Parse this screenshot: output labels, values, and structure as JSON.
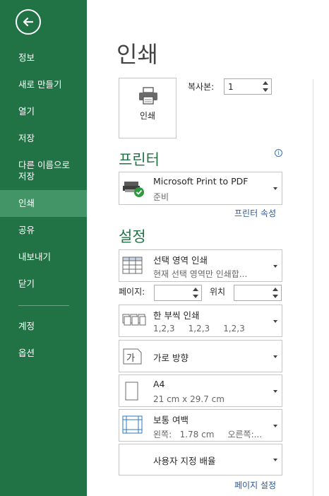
{
  "sidebar": {
    "items": [
      {
        "label": "정보"
      },
      {
        "label": "새로 만들기"
      },
      {
        "label": "열기"
      },
      {
        "label": "저장"
      },
      {
        "label": "다른 이름으로\n저장"
      },
      {
        "label": "인쇄"
      },
      {
        "label": "공유"
      },
      {
        "label": "내보내기"
      },
      {
        "label": "닫기"
      },
      {
        "label": "계정"
      },
      {
        "label": "옵션"
      }
    ],
    "active_index": 5
  },
  "page": {
    "title": "인쇄"
  },
  "print": {
    "button_label": "인쇄",
    "copies_label": "복사본:",
    "copies_value": "1"
  },
  "printer": {
    "heading": "프린터",
    "name": "Microsoft Print to PDF",
    "status": "준비",
    "properties_link": "프린터 속성"
  },
  "settings": {
    "heading": "설정",
    "scope": {
      "title": "선택 영역 인쇄",
      "subtitle": "현재 선택 영역만 인쇄합..."
    },
    "pages": {
      "label": "페이지:",
      "from": "",
      "to_label": "위치",
      "to": ""
    },
    "collate": {
      "title": "한 부씩 인쇄",
      "subtitle": "1,2,3     1,2,3     1,2,3"
    },
    "orientation": {
      "title": "가로 방향"
    },
    "paper": {
      "title": "A4",
      "subtitle": "21 cm x 29.7 cm"
    },
    "margins": {
      "title": "보통 여백",
      "subtitle": "왼쪽:   1.78 cm     오른쪽:..."
    },
    "scaling": {
      "title": "사용자 지정 배율"
    },
    "page_setup_link": "페이지 설정"
  },
  "colors": {
    "sidebar": "#217346",
    "sidebar_active": "#439467",
    "accent": "#217346",
    "link": "#2b5797"
  }
}
